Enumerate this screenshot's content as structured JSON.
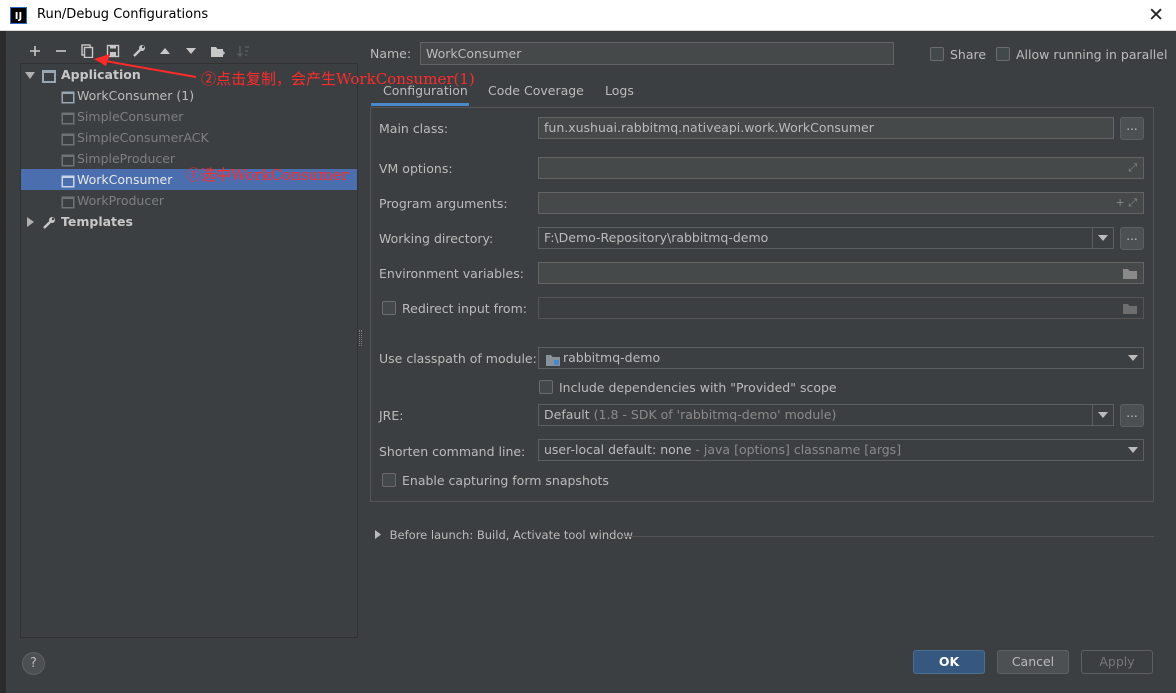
{
  "window": {
    "title": "Run/Debug Configurations",
    "app_icon": "IJ",
    "close_glyph": "✕"
  },
  "toolbar": {
    "icons": [
      "add-icon",
      "remove-icon",
      "copy-icon",
      "save-icon",
      "wrench-icon",
      "move-up-icon",
      "move-down-icon",
      "folder-icon",
      "sort-icon"
    ]
  },
  "tree": {
    "group": "Application",
    "items": [
      {
        "label": "WorkConsumer (1)",
        "state": "normal"
      },
      {
        "label": "SimpleConsumer",
        "state": "dim"
      },
      {
        "label": "SimpleConsumerACK",
        "state": "dim"
      },
      {
        "label": "SimpleProducer",
        "state": "dim"
      },
      {
        "label": "WorkConsumer",
        "state": "selected"
      },
      {
        "label": "WorkProducer",
        "state": "dim"
      }
    ],
    "templates": "Templates"
  },
  "annotations": {
    "copy_note": "②点击复制，会产生WorkConsumer(1)",
    "select_note": "①选中WorkConsumer"
  },
  "header": {
    "name_label": "Name:",
    "name_value": "WorkConsumer",
    "share_label": "Share",
    "parallel_label": "Allow running in parallel"
  },
  "tabs": [
    "Configuration",
    "Code Coverage",
    "Logs"
  ],
  "form": {
    "main_class_label": "Main class:",
    "main_class_value": "fun.xushuai.rabbitmq.nativeapi.work.WorkConsumer",
    "vm_options_label": "VM options:",
    "vm_options_value": "",
    "program_args_label": "Program arguments:",
    "program_args_value": "",
    "working_dir_label": "Working directory:",
    "working_dir_value": "F:\\Demo-Repository\\rabbitmq-demo",
    "env_vars_label": "Environment variables:",
    "env_vars_value": "",
    "redirect_label": "Redirect input from:",
    "classpath_label": "Use classpath of module:",
    "classpath_value": "rabbitmq-demo",
    "include_deps_label": "Include dependencies with \"Provided\" scope",
    "jre_label": "JRE:",
    "jre_value_main": "Default",
    "jre_value_detail": "(1.8 - SDK of 'rabbitmq-demo' module)",
    "shorten_label": "Shorten command line:",
    "shorten_value_main": "user-local default: none",
    "shorten_value_detail": "- java [options] classname [args]",
    "snapshots_label": "Enable capturing form snapshots",
    "browse_glyph": "..."
  },
  "before_launch": "Before launch: Build, Activate tool window",
  "buttons": {
    "ok": "OK",
    "cancel": "Cancel",
    "apply": "Apply",
    "help": "?"
  },
  "colors": {
    "background": "#3c3f41",
    "selection": "#4b6eaf",
    "annotation": "#ff2b2b",
    "ok_button": "#365880",
    "tab_underline": "#4a88c7"
  }
}
